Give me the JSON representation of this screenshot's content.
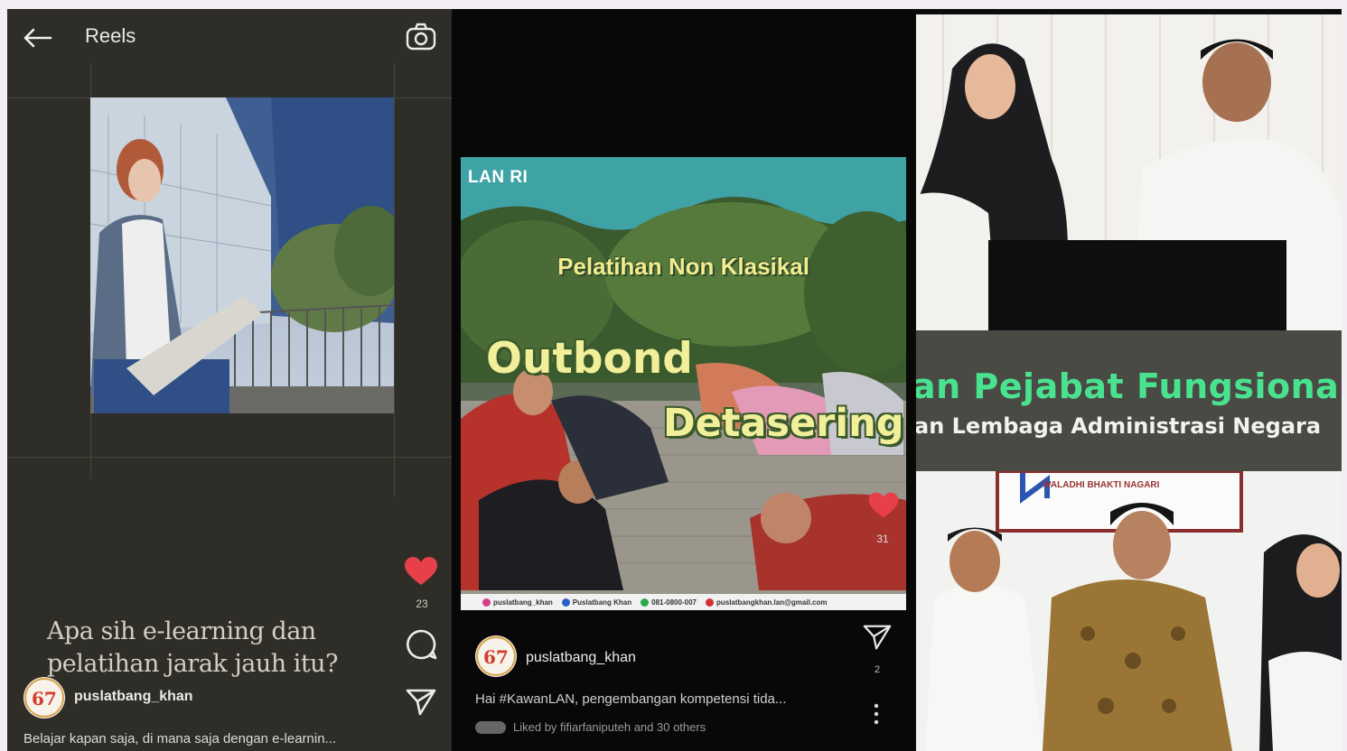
{
  "reels_panel": {
    "title": "Reels",
    "headline_line1": "Apa sih e-learning dan",
    "headline_line2": "pelatihan jarak jauh itu?",
    "username": "puslatbang_khan",
    "caption": "Belajar kapan saja, di mana saja dengan e-learnin...",
    "like_count": "23",
    "icons": [
      "back-arrow-icon",
      "camera-icon",
      "heart-icon",
      "comment-icon",
      "send-icon"
    ]
  },
  "post_panel": {
    "logo": "LAN RI",
    "subtitle": "Pelatihan Non Klasikal",
    "title_line1": "Outbond",
    "title_line2": "Detasering",
    "like_count": "31",
    "footer": [
      "puslatbang_khan",
      "Puslatbang Khan",
      "081-0800-007",
      "puslatbangkhan.lan@gmail.com"
    ],
    "username": "puslatbang_khan",
    "share_count": "2",
    "caption": "Hai #KawanLAN, pengembangan kompetensi tida...",
    "liked_by": "Liked by fifiarfaniputeh and 30 others"
  },
  "photo_panel": {
    "banner_line1": "an  Pejabat Fungsional",
    "banner_line2": "an Lembaga Administrasi Negara",
    "sign_text": "WALADHI BHAKTI NAGARI"
  },
  "colors": {
    "reels_bg": "#2e2d27",
    "banner_green": "#49e38f",
    "post_title_yellow": "#f1ef9a",
    "heart_red": "#e8404a"
  }
}
